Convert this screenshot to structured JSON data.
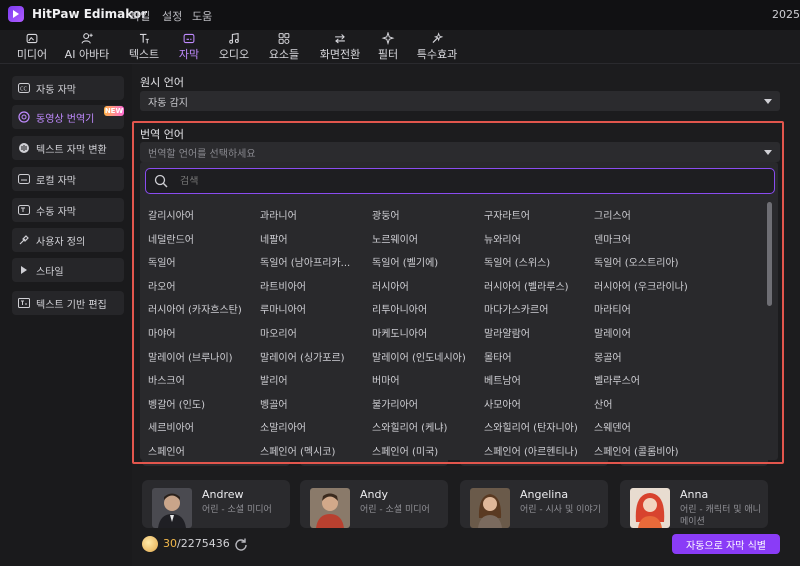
{
  "app": {
    "name": "HitPaw Edimakor",
    "date": "2025-"
  },
  "menu": [
    "파일",
    "설정",
    "도움"
  ],
  "toolbar": [
    {
      "label": "미디어",
      "icon": "media-icon"
    },
    {
      "label": "AI 아바타",
      "icon": "ai-avatar-icon"
    },
    {
      "label": "텍스트",
      "icon": "text-icon"
    },
    {
      "label": "자막",
      "icon": "subtitle-icon",
      "active": true
    },
    {
      "label": "오디오",
      "icon": "audio-icon"
    },
    {
      "label": "요소들",
      "icon": "elements-icon"
    },
    {
      "label": "화면전환",
      "icon": "transition-icon"
    },
    {
      "label": "필터",
      "icon": "filter-icon"
    },
    {
      "label": "특수효과",
      "icon": "effects-icon"
    }
  ],
  "sidebar": {
    "items": [
      {
        "label": "자동 자막",
        "icon": "cc-icon"
      },
      {
        "label": "동영상 번역기",
        "icon": "translate-icon",
        "active": true,
        "badge": "NEW"
      },
      {
        "label": "텍스트 자막 변환",
        "icon": "tts-icon"
      },
      {
        "label": "로컬 자막",
        "icon": "local-subtitle-icon"
      },
      {
        "label": "수동 자막",
        "icon": "manual-subtitle-icon"
      },
      {
        "label": "사용자 정의",
        "icon": "custom-icon"
      },
      {
        "label": "스타일",
        "icon": "triangle-right-icon"
      },
      {
        "label": "텍스트 기반 편집",
        "icon": "text-edit-icon"
      }
    ]
  },
  "source": {
    "label": "원시 언어",
    "value": "자동 감지"
  },
  "target": {
    "label": "번역 언어",
    "placeholder": "번역할 언어를 선택하세요"
  },
  "search": {
    "placeholder": "검색"
  },
  "languages": [
    "갈리시아어",
    "과라니어",
    "광둥어",
    "구자라트어",
    "그리스어",
    "네덜란드어",
    "네팔어",
    "노르웨이어",
    "뉴와리어",
    "덴마크어",
    "독일어",
    "독일어 (남아프리카...",
    "독일어 (벨기에)",
    "독일어 (스위스)",
    "독일어 (오스트리아)",
    "라오어",
    "라트비아어",
    "러시아어",
    "러시아어 (벨라루스)",
    "러시아어 (우크라이나)",
    "러시아어 (카자흐스탄)",
    "루마니아어",
    "리투아니아어",
    "마다가스카르어",
    "마라티어",
    "마야어",
    "마오리어",
    "마케도니아어",
    "말라얄람어",
    "말레이어",
    "말레이어 (브루나이)",
    "말레이어 (싱가포르)",
    "말레이어 (인도네시아)",
    "몰타어",
    "몽골어",
    "바스크어",
    "발리어",
    "버마어",
    "베트남어",
    "벨라루스어",
    "벵갈어 (인도)",
    "벵골어",
    "불가리아어",
    "사모아어",
    "산어",
    "세르비아어",
    "소말리아어",
    "스와힐리어 (케냐)",
    "스와힐리어 (탄자니아)",
    "스웨덴어",
    "스페인어",
    "스페인어 (멕시코)",
    "스페인어 (미국)",
    "스페인어 (아르헨티나)",
    "스페인어 (콜롬비아)"
  ],
  "avatars": [
    {
      "name": "Andrew",
      "desc": "어린 - 소셜 미디어"
    },
    {
      "name": "Andy",
      "desc": "어린 - 소셜 미디어"
    },
    {
      "name": "Angelina",
      "desc": "어린 - 시사 및 이야기"
    },
    {
      "name": "Anna",
      "desc": "어린 - 캐릭터 및 애니메이션"
    }
  ],
  "credits": {
    "used": "30",
    "total": "/2275436"
  },
  "auto_button": "자동으로 자막 식별",
  "colors": {
    "accent": "#8a3cf7",
    "highlight": "#e2564d",
    "active_text": "#c08bff"
  }
}
